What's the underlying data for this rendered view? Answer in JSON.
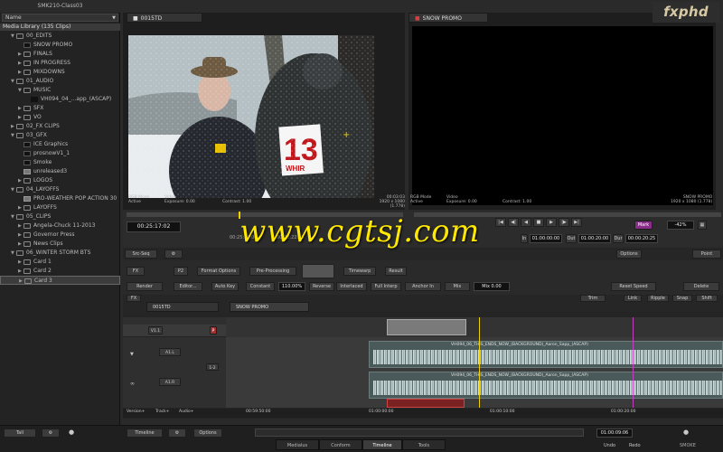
{
  "left_panel": {
    "title": "SMK210-Class03",
    "name_header": "Name",
    "library": "Media Library (135 Clips)",
    "items": [
      {
        "label": "00_EDITS",
        "icon": "folder-icon",
        "indent": 1,
        "open": true
      },
      {
        "label": "SNOW PROMO",
        "icon": "sequence-icon",
        "indent": 2
      },
      {
        "label": "FINALS",
        "icon": "folder-icon",
        "indent": 2
      },
      {
        "label": "IN PROGRESS",
        "icon": "folder-icon",
        "indent": 2
      },
      {
        "label": "MIXDOWNS",
        "icon": "folder-icon",
        "indent": 2
      },
      {
        "label": "01_AUDIO",
        "icon": "folder-icon",
        "indent": 1,
        "open": true
      },
      {
        "label": "MUSIC",
        "icon": "folder-icon",
        "indent": 2,
        "open": true
      },
      {
        "label": "VH094_04_...app_(ASCAP)",
        "icon": "audio-icon",
        "indent": 3
      },
      {
        "label": "SFX",
        "icon": "folder-icon",
        "indent": 2
      },
      {
        "label": "VO",
        "icon": "folder-icon",
        "indent": 2
      },
      {
        "label": "02_FX CLIPS",
        "icon": "folder-icon",
        "indent": 1
      },
      {
        "label": "03_GFX",
        "icon": "folder-icon",
        "indent": 1,
        "open": true
      },
      {
        "label": "ICE Graphics",
        "icon": "clip-icon",
        "indent": 2
      },
      {
        "label": "prosnowV1_1",
        "icon": "clip-icon",
        "indent": 2
      },
      {
        "label": "Smoke",
        "icon": "clip-icon",
        "indent": 2
      },
      {
        "label": "unreleased3",
        "icon": "image-icon",
        "indent": 2
      },
      {
        "label": "LOGOS",
        "icon": "folder-icon",
        "indent": 2
      },
      {
        "label": "04_LAYOFFS",
        "icon": "folder-icon",
        "indent": 1,
        "open": true
      },
      {
        "label": "PRO-WEATHER POP ACTION 30",
        "icon": "image-icon",
        "indent": 2
      },
      {
        "label": "LAYOFFS",
        "icon": "folder-icon",
        "indent": 2
      },
      {
        "label": "05_CLIPS",
        "icon": "folder-icon",
        "indent": 1,
        "open": true
      },
      {
        "label": "Angela-Chuck 11-2013",
        "icon": "folder-icon",
        "indent": 2
      },
      {
        "label": "Governor Press",
        "icon": "folder-icon",
        "indent": 2
      },
      {
        "label": "News Clips",
        "icon": "folder-icon",
        "indent": 2
      },
      {
        "label": "06_WINTER STORM BTS",
        "icon": "folder-icon",
        "indent": 1,
        "open": true
      },
      {
        "label": "Card 1",
        "icon": "folder-icon",
        "indent": 2
      },
      {
        "label": "Card 2",
        "icon": "folder-icon",
        "indent": 2
      },
      {
        "label": "Card 3",
        "icon": "folder-icon",
        "indent": 2,
        "selected": true
      }
    ]
  },
  "viewer1": {
    "tab": "0015TD",
    "info_left": [
      "RGB Mode",
      "Active"
    ],
    "info_mid": [
      "Video",
      "Exposure: 0.00"
    ],
    "contrast": "Contrast: 1.00",
    "info_right": [
      "00:03:03",
      "1920 x 1080 (1.778)"
    ],
    "timecode": "00:25:17:02",
    "sub_tc1": "00:25:14:00",
    "sub_tc2": "00:26:22:18"
  },
  "viewer2": {
    "tab": "SNOW PROMO",
    "info_left": [
      "RGB Mode",
      "Active"
    ],
    "info_mid": [
      "Video",
      "Exposure: 0.00"
    ],
    "contrast": "Contrast: 1.00",
    "info_right": [
      "SNOW PROMO",
      "1920 x 1080 (1.778)"
    ]
  },
  "transport": {
    "in_label": "In",
    "in_tc": "01:00:00:00",
    "out_label": "Out",
    "out_tc": "01:00:20:00",
    "dur_label": "Dur",
    "dur_tc": "00:00:20:25",
    "zoom": "-42%",
    "mark": "Mark",
    "options": "Options",
    "point": "Point",
    "src_seq": "Src-Seq"
  },
  "fx": {
    "fx_label": "FX",
    "p2": "P2",
    "format_options": "Format Options",
    "pre_processing": "Pre-Processing",
    "timewarp": "Timewarp",
    "result": "Result",
    "render": "Render",
    "editor": "Editor...",
    "auto_key": "Auto Key",
    "constant": "Constant",
    "speed": "110.00%",
    "reverse": "Reverse",
    "interlaced": "Interlaced",
    "full_interp": "Full Interp",
    "anchor_in": "Anchor In",
    "mix": "Mix",
    "mix_val": "Mix 0.00",
    "reset_speed": "Reset Speed",
    "delete": "Delete"
  },
  "timeline": {
    "tab1": "0015TD",
    "tab2": "SNOW PROMO",
    "fx_tab": "FX",
    "tools": [
      "Trim",
      "Link",
      "Ripple",
      "Snap",
      "Shift"
    ],
    "v1": "V1.1",
    "v1_b": "V1",
    "a1": "A1.L",
    "a2": "A1.R",
    "clip1": "VH094_06_THIS_ENDS_NOW_(BACKGROUND)_Aaron_Sapp_(ASCAP)",
    "clip2": "VH094_06_THIS_ENDS_NOW_(BACKGROUND)_Aaron_Sapp_(ASCAP)",
    "ruler": [
      "00:59:50:00",
      "01:00:00:00",
      "01:00:10:00",
      "01:00:20:00"
    ],
    "footer": [
      "Version+",
      "Track+",
      "Audio+"
    ],
    "p_label": "P",
    "ab": "1-2"
  },
  "bottom": {
    "tools": "Tall",
    "timeline": "Timeline",
    "options": "Options",
    "tc": "01:00:09:06",
    "tabs": [
      "Medialus",
      "Conform",
      "Timeline",
      "Tools"
    ],
    "active_tab": "Timeline",
    "undo": "Undo",
    "redo": "Redo",
    "smoke": "SMOKE"
  },
  "watermark": "www.cgtsj.com",
  "logo": "fxphd",
  "news_logo": {
    "number": "13",
    "letters": "WHIR"
  }
}
